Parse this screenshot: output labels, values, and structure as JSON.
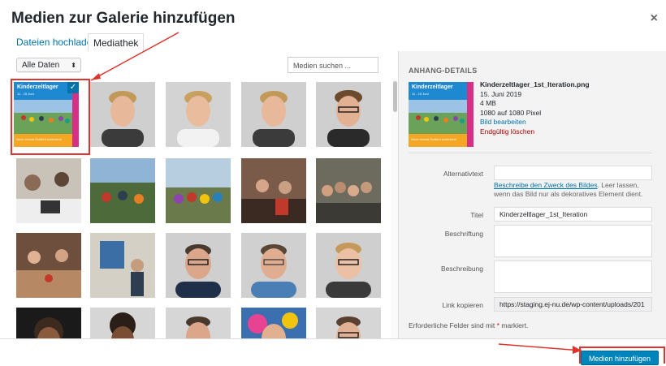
{
  "modal": {
    "title": "Medien zur Galerie hinzufügen",
    "close": "×"
  },
  "tabs": [
    {
      "label": "Dateien hochladen",
      "active": false
    },
    {
      "label": "Mediathek",
      "active": true
    }
  ],
  "toolbar": {
    "filter_value": "Alle Daten",
    "search_placeholder": "Medien suchen ..."
  },
  "details": {
    "heading": "ANHANG-DETAILS",
    "filename": "Kinderzeltlager_1st_Iteration.png",
    "date": "15. Juni 2019",
    "size": "4 MB",
    "dimensions": "1080 auf 1080 Pixel",
    "edit_link": "Bild bearbeiten",
    "delete_link": "Endgültig löschen",
    "fields": {
      "alt_label": "Alternativtext",
      "alt_value": "",
      "alt_hint_link": "Beschreibe den Zweck des Bildes",
      "alt_hint_rest": ". Leer lassen, wenn das Bild nur als dekoratives Element dient.",
      "title_label": "Titel",
      "title_value": "Kinderzeltlager_1st_Iteration",
      "caption_label": "Beschriftung",
      "caption_value": "",
      "description_label": "Beschreibung",
      "description_value": "",
      "copy_label": "Link kopieren",
      "copy_value": "https://staging.ej-nu.de/wp-content/uploads/201"
    },
    "required_text": "Erforderliche Felder sind mit",
    "required_star": "*",
    "required_end": "markiert."
  },
  "selected_thumb": {
    "title": "Kinderzeltlager",
    "subtitle": "11 - 15 Juni",
    "banner": "Noch einmal Rotlicht schenken!"
  },
  "footer": {
    "insert_button": "Medien hinzufügen"
  },
  "colors": {
    "accent": "#0073aa",
    "primary_button": "#0085ba",
    "danger": "#a00000",
    "highlight_frame": "#e0332b"
  }
}
